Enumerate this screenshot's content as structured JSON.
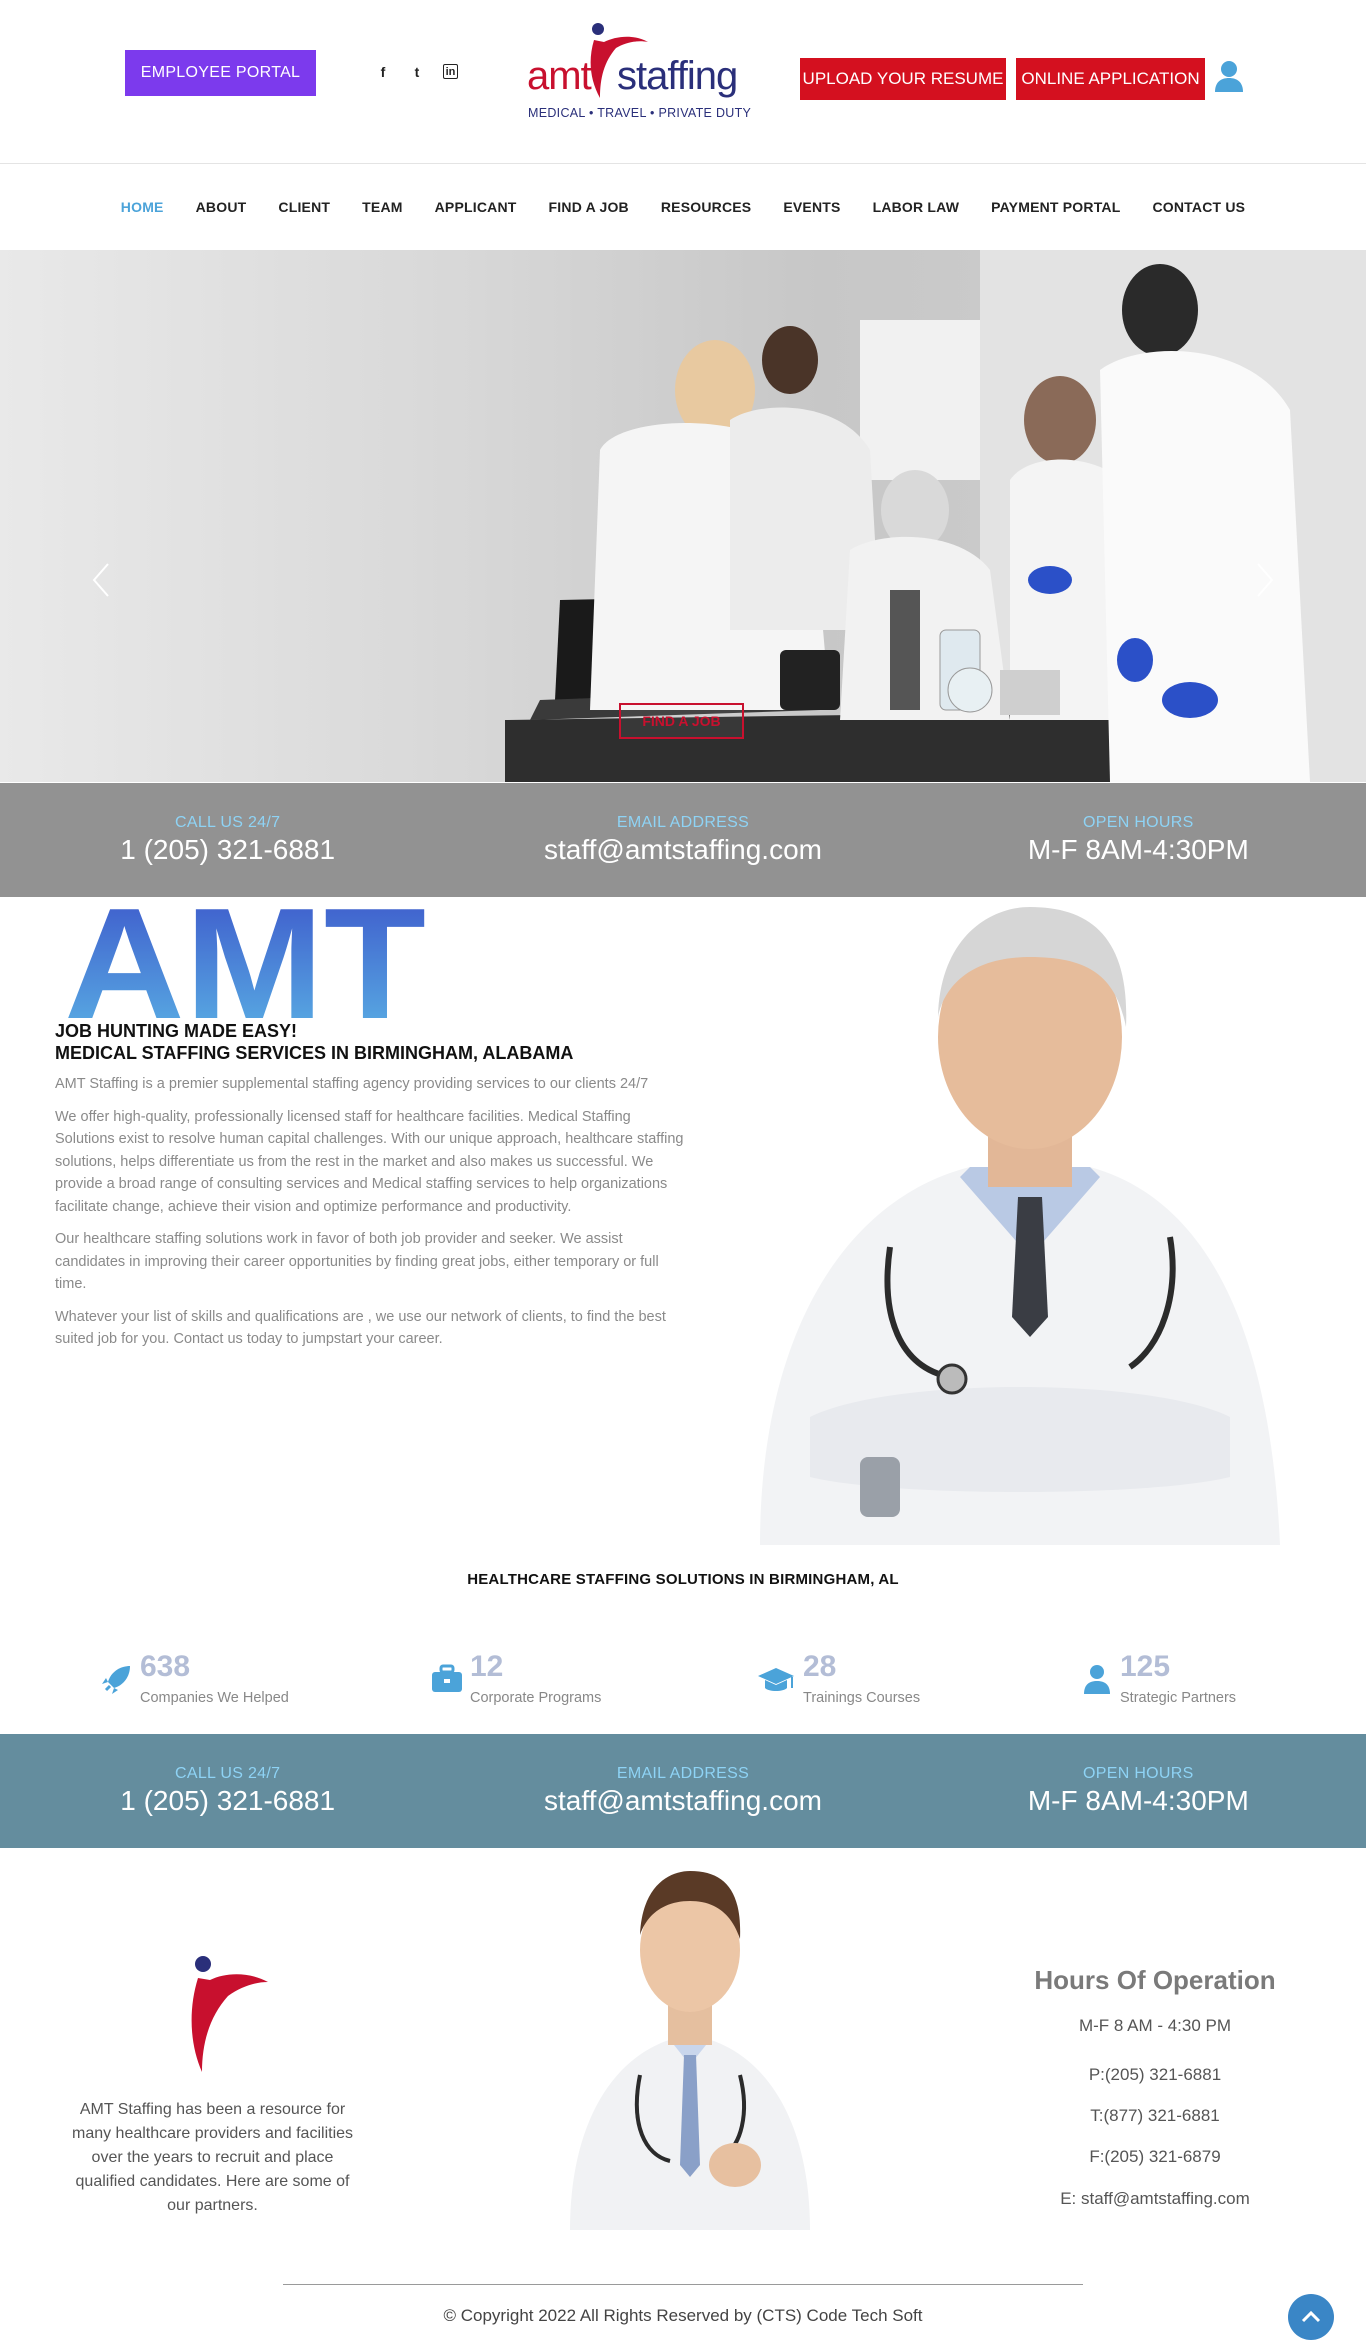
{
  "header": {
    "employee_portal": "EMPLOYEE PORTAL",
    "social_icons": [
      "facebook-icon",
      "twitter-icon",
      "linkedin-icon"
    ],
    "social_glyphs": [
      "f",
      "t",
      "in"
    ],
    "logo": {
      "word1": "amt",
      "word2": "staffing",
      "tagline": "MEDICAL • TRAVEL • PRIVATE DUTY"
    },
    "upload_resume": "UPLOAD YOUR RESUME",
    "online_application": "ONLINE APPLICATION",
    "account_icon": "user-icon"
  },
  "nav": {
    "items": [
      "HOME",
      "ABOUT",
      "CLIENT",
      "TEAM",
      "APPLICANT",
      "FIND A JOB",
      "RESOURCES",
      "EVENTS",
      "LABOR LAW",
      "PAYMENT PORTAL",
      "CONTACT US"
    ],
    "active": "HOME"
  },
  "hero": {
    "cta": "FIND A JOB",
    "prev_icon": "chevron-left-icon",
    "next_icon": "chevron-right-icon"
  },
  "contact_bar": {
    "call_label": "CALL US 24/7",
    "call_value": "1 (205) 321-6881",
    "email_label": "EMAIL ADDRESS",
    "email_value": "staff@amtstaffing.com",
    "hours_label": "OPEN HOURS",
    "hours_value": "M-F 8AM-4:30PM"
  },
  "about": {
    "brand_mark": "AMT",
    "heading_line1": "JOB HUNTING MADE EASY!",
    "heading_line2": "MEDICAL STAFFING SERVICES IN BIRMINGHAM, ALABAMA",
    "paragraphs": [
      "AMT Staffing is a premier supplemental staffing agency providing services to our clients 24/7",
      "We offer high-quality, professionally licensed staff for healthcare facilities. Medical Staffing Solutions exist to resolve human capital challenges. With our unique approach, healthcare staffing solutions, helps differentiate us from the rest in the market and also makes us successful. We provide a broad range of consulting services and Medical staffing services to help organizations facilitate change, achieve their vision and optimize performance and productivity.",
      "Our healthcare staffing solutions work in favor of both job provider and seeker. We assist candidates in improving their career opportunities by finding great jobs, either temporary or full time.",
      "Whatever your list of skills and qualifications are , we use our network of clients, to find the best suited job for you. Contact us today to jumpstart your career."
    ]
  },
  "solutions_heading": "HEALTHCARE STAFFING SOLUTIONS IN BIRMINGHAM, AL",
  "stats": [
    {
      "icon": "rocket-icon",
      "number": "638",
      "caption": "Companies We Helped"
    },
    {
      "icon": "briefcase-icon",
      "number": "12",
      "caption": "Corporate Programs"
    },
    {
      "icon": "graduation-cap-icon",
      "number": "28",
      "caption": "Trainings Courses"
    },
    {
      "icon": "user-icon",
      "number": "125",
      "caption": "Strategic Partners"
    }
  ],
  "footer": {
    "about": "AMT Staffing has been a resource for many healthcare providers and facilities over the years to recruit and place qualified candidates. Here are some of our partners.",
    "hours_title": "Hours Of Operation",
    "hours": "M-F 8 AM - 4:30 PM",
    "phone": "P:(205) 321-6881",
    "toll_free": "T:(877) 321-6881",
    "fax": "F:(205) 321-6879",
    "email": "E: staff@amtstaffing.com",
    "copyright": "© Copyright 2022 All Rights Reserved by (CTS) Code Tech Soft",
    "to_top_icon": "chevron-up-icon"
  },
  "colors": {
    "accent_purple": "#7c3aed",
    "accent_red": "#d4101f",
    "nav_active": "#4ba3d9",
    "contact_bar_1": "#929292",
    "contact_bar_2": "#648d9e",
    "label_blue": "#8ed3f5"
  }
}
